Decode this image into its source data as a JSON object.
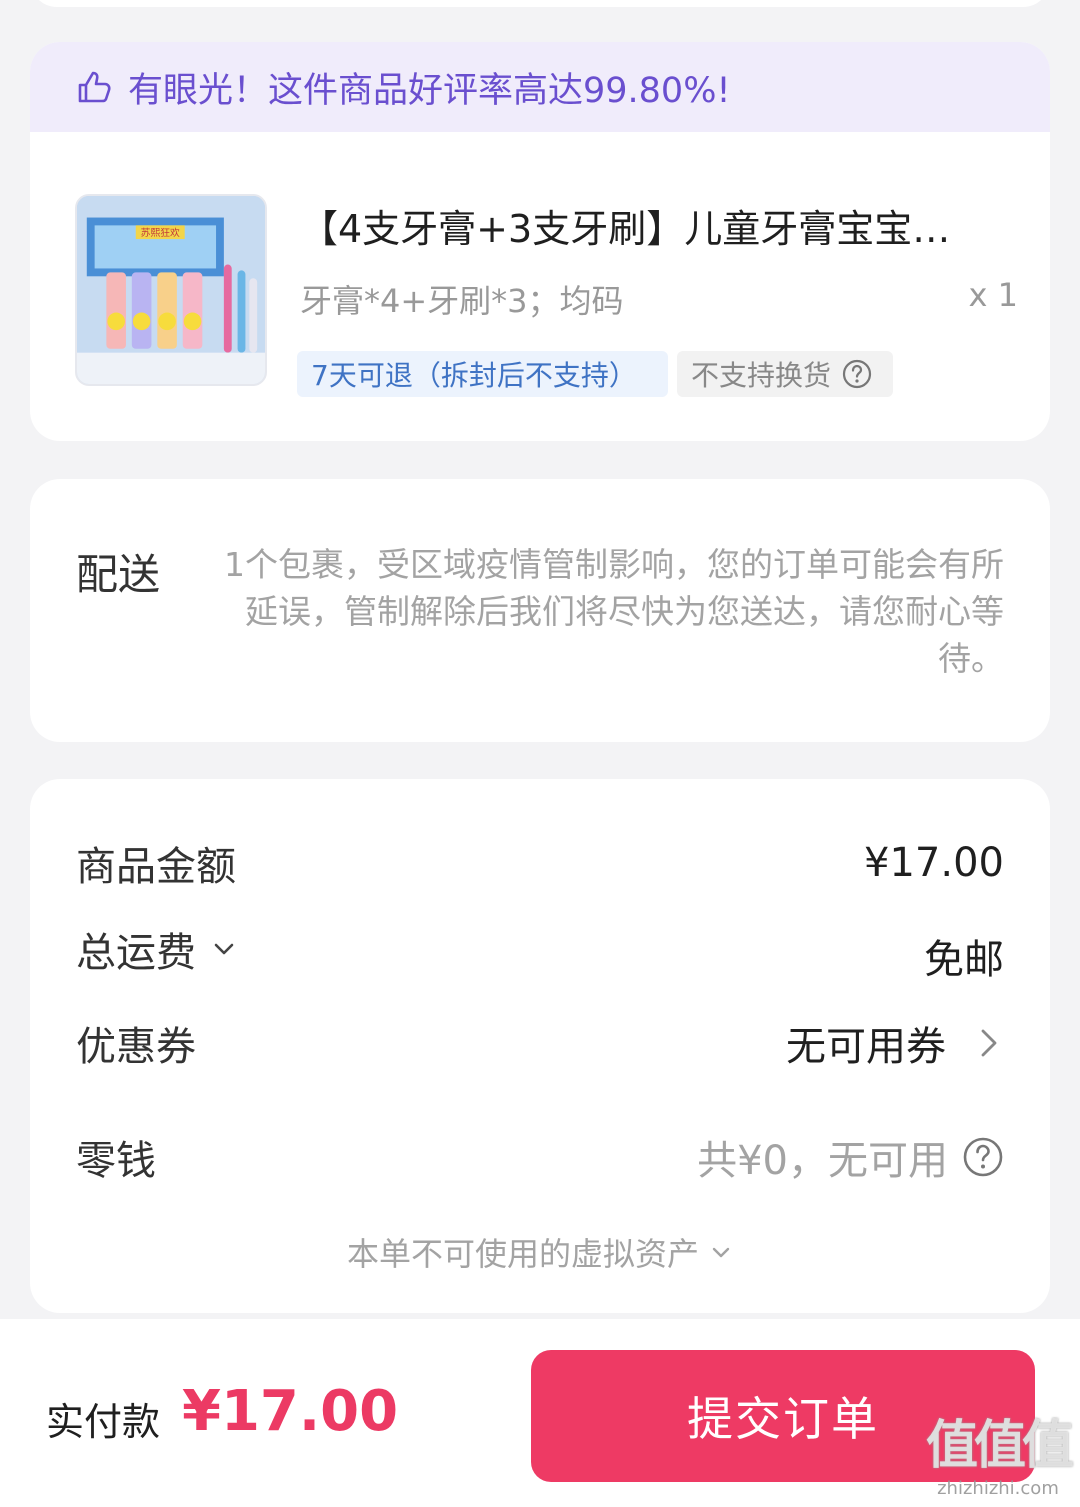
{
  "praise": {
    "text": "有眼光！这件商品好评率高达99.80%!"
  },
  "product": {
    "title": "【4支牙膏+3支牙刷】儿童牙膏宝宝…",
    "spec": "牙膏*4+牙刷*3；均码",
    "quantity": "x 1",
    "tags": {
      "return": "7天可退（拆封后不支持）",
      "exchange": "不支持换货"
    },
    "thumb_caption": "苏熙狂欢"
  },
  "delivery": {
    "label": "配送",
    "text": "1个包裹，受区域疫情管制影响，您的订单可能会有所延误，管制解除后我们将尽快为您送达，请您耐心等待。"
  },
  "summary": {
    "goods_amount": {
      "label": "商品金额",
      "value": "¥17.00"
    },
    "shipping": {
      "label": "总运费",
      "value": "免邮"
    },
    "coupon": {
      "label": "优惠券",
      "value": "无可用券"
    },
    "change": {
      "label": "零钱",
      "value": "共¥0，无可用"
    },
    "virtual_assets": "本单不可使用的虚拟资产"
  },
  "footer": {
    "pay_label": "实付款",
    "pay_amount": "¥17.00",
    "submit_label": "提交订单"
  },
  "watermark": {
    "logo": "值值值",
    "url": "zhizhizhi.com"
  },
  "colors": {
    "accent": "#ee3a64",
    "praise_text": "#6a4fcf",
    "praise_bg": "#f0ecfb",
    "return_tag": "#3f73c4"
  }
}
